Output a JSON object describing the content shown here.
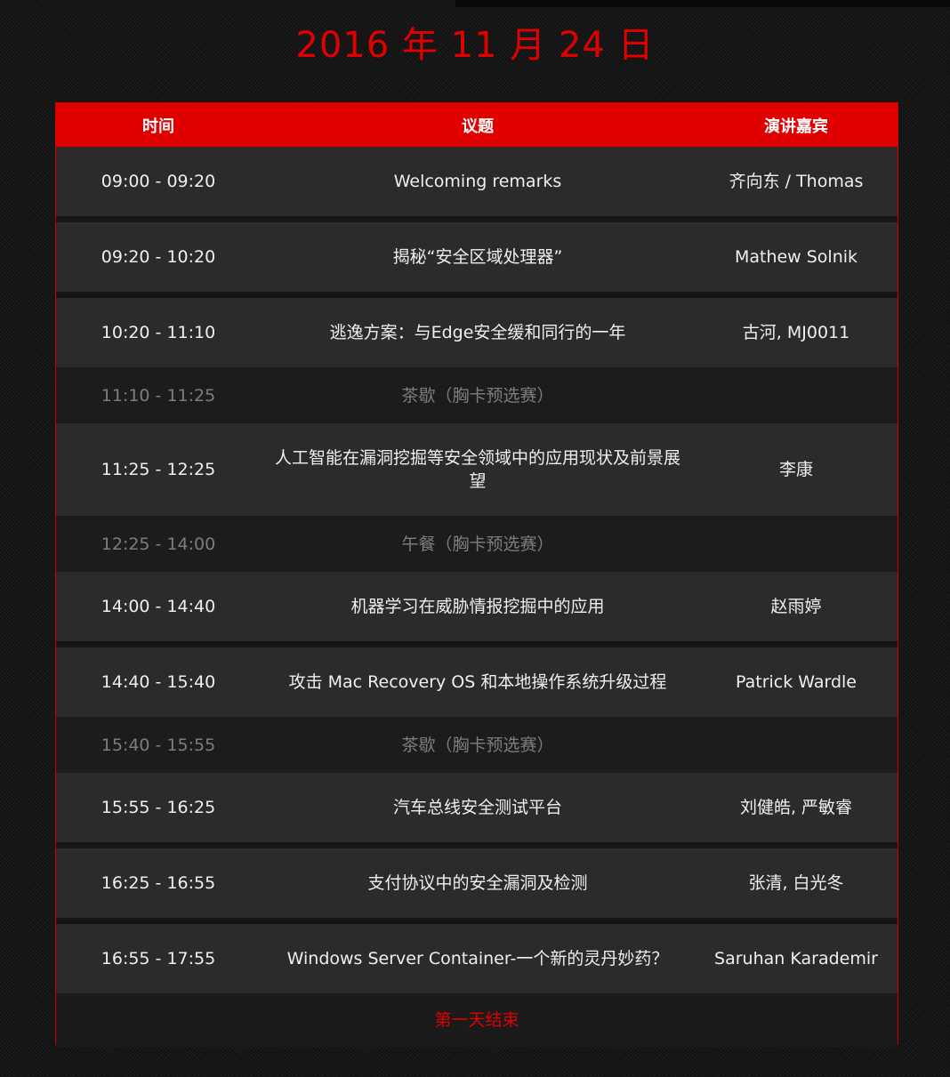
{
  "date_title": "2016 年 11 月 24 日",
  "header": {
    "time": "时间",
    "topic": "议题",
    "speaker": "演讲嘉宾"
  },
  "sessions": [
    {
      "time": "09:00 - 09:20",
      "topic": "Welcoming remarks",
      "speaker": "齐向东 / Thomas"
    },
    {
      "time": "09:20 - 10:20",
      "topic": "揭秘“安全区域处理器”",
      "speaker": "Mathew Solnik"
    },
    {
      "time": "10:20 - 11:10",
      "topic": "逃逸方案：与Edge安全缓和同行的一年",
      "speaker": "古河, MJ0011"
    },
    {
      "time": "11:10 - 11:25",
      "topic": "茶歇（胸卡预选赛）",
      "speaker": ""
    },
    {
      "time": "11:25 - 12:25",
      "topic": "人工智能在漏洞挖掘等安全领域中的应用现状及前景展望",
      "speaker": "李康"
    },
    {
      "time": "12:25 - 14:00",
      "topic": "午餐（胸卡预选赛）",
      "speaker": ""
    },
    {
      "time": "14:00 - 14:40",
      "topic": "机器学习在威胁情报挖掘中的应用",
      "speaker": "赵雨婷"
    },
    {
      "time": "14:40 - 15:40",
      "topic": "攻击 Mac Recovery OS 和本地操作系统升级过程",
      "speaker": "Patrick Wardle"
    },
    {
      "time": "15:40 - 15:55",
      "topic": "茶歇（胸卡预选赛）",
      "speaker": ""
    },
    {
      "time": "15:55 - 16:25",
      "topic": "汽车总线安全测试平台",
      "speaker": "刘健皓, 严敏睿"
    },
    {
      "time": "16:25 - 16:55",
      "topic": "支付协议中的安全漏洞及检测",
      "speaker": "张清, 白光冬"
    },
    {
      "time": "16:55 - 17:55",
      "topic": "Windows Server Container-一个新的灵丹妙药？",
      "speaker": "Saruhan Karademir"
    }
  ],
  "footer": "第一天结束",
  "colors": {
    "accent": "#e00000",
    "row_bg": "#2b2b2b",
    "break_bg": "#1c1c1c",
    "break_text": "#7d7d7d"
  }
}
